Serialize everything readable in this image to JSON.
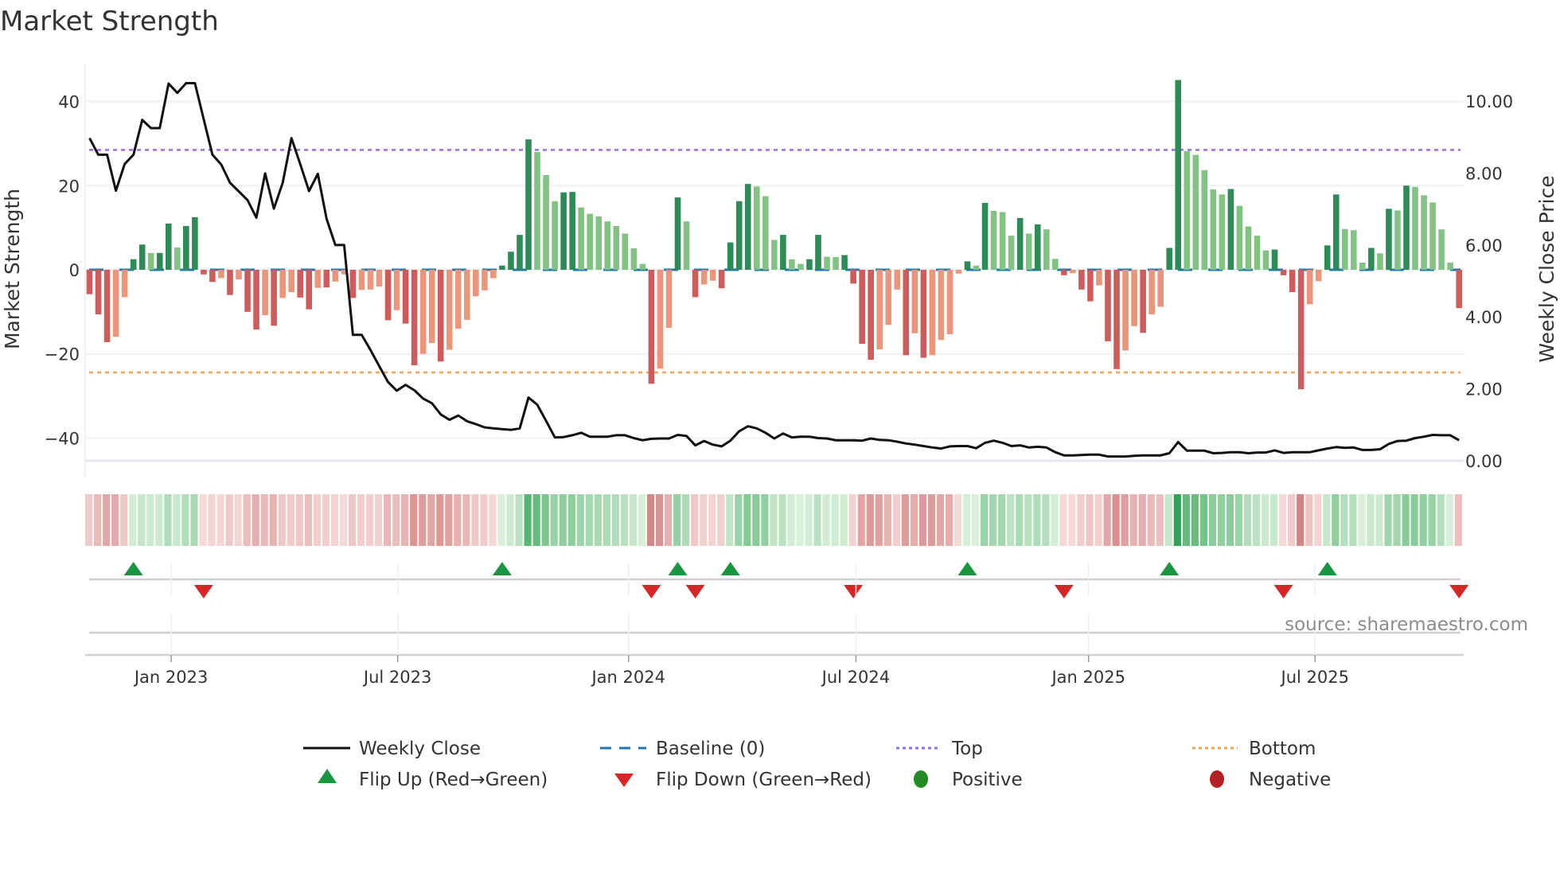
{
  "title": "Market Strength",
  "source": "source: sharemaestro.com",
  "colors": {
    "strong_pos": "#2e8b57",
    "weak_pos": "#82c283",
    "strong_neg": "#cd5c5c",
    "weak_neg": "#e9967a",
    "line": "#111111",
    "baseline": "#1f77b4",
    "top": "#9370db",
    "bottom": "#f4a460",
    "flip_up": "#1a9641",
    "flip_down": "#d62728",
    "positive": "#228b22",
    "negative": "#b22222"
  },
  "legend": [
    {
      "label": "Weekly Close",
      "icon": "solid-line"
    },
    {
      "label": "Baseline (0)",
      "icon": "dashed-line"
    },
    {
      "label": "Top",
      "icon": "dotted-line-purple"
    },
    {
      "label": "Bottom",
      "icon": "dotted-line-orange"
    },
    {
      "label": "Flip Up (Red→Green)",
      "icon": "triangle-up"
    },
    {
      "label": "Flip Down (Green→Red)",
      "icon": "triangle-down"
    },
    {
      "label": "Positive",
      "icon": "circle-green"
    },
    {
      "label": "Negative",
      "icon": "circle-red"
    }
  ],
  "chart_data": {
    "type": "bar",
    "title": "Market Strength",
    "ylabel": "Market Strength",
    "y2label": "Weekly Close Price",
    "ylim": [
      -45.4,
      48.8
    ],
    "y2lim": [
      0,
      11.02
    ],
    "yticks": [
      -40,
      -20,
      0,
      20,
      40
    ],
    "ytick_labels": [
      "−40",
      "−20",
      "0",
      "20",
      "40"
    ],
    "y2ticks": [
      0,
      2,
      4,
      6,
      8,
      10
    ],
    "y2tick_labels": [
      "0.00",
      "2.00",
      "4.00",
      "6.00",
      "8.00",
      "10.00"
    ],
    "xticks": [
      {
        "week": 10.3,
        "label": "Jan 2023"
      },
      {
        "week": 36.1,
        "label": "Jul 2023"
      },
      {
        "week": 62.4,
        "label": "Jan 2024"
      },
      {
        "week": 88.3,
        "label": "Jul 2024"
      },
      {
        "week": 114.8,
        "label": "Jan 2025"
      },
      {
        "week": 140.6,
        "label": "Jul 2025"
      }
    ],
    "top_level": 28.5,
    "bottom_level": -24.4,
    "baseline": 0,
    "grid": true,
    "legend_position": "bottom",
    "strength": [
      -5.8,
      -10.6,
      -17.2,
      -15.9,
      -6.5,
      2.5,
      6,
      4,
      4,
      11,
      5.3,
      10.4,
      12.5,
      -1.1,
      -2.9,
      -2,
      -6,
      -2.3,
      -10,
      -14.2,
      -10.8,
      -13.3,
      -6.7,
      -5.3,
      -6.6,
      -9.4,
      -4.3,
      -4.2,
      -2.8,
      -1.1,
      -6.7,
      -4.8,
      -4.7,
      -4,
      -12,
      -9.6,
      -12.8,
      -22.7,
      -20,
      -17.4,
      -21.8,
      -19,
      -14,
      -11.9,
      -6.3,
      -4.9,
      -2,
      1,
      4.3,
      8.3,
      31,
      28,
      22.5,
      16.3,
      18.4,
      18.5,
      14.8,
      13.3,
      12.7,
      11.5,
      10.4,
      8.6,
      5.1,
      1.4,
      -27.1,
      -23.5,
      -13.8,
      17.2,
      11.5,
      -6.5,
      -3.5,
      -2.6,
      -4.4,
      6.5,
      16.3,
      20.4,
      19.8,
      17.5,
      7.1,
      8.3,
      2.5,
      1.4,
      2.5,
      8.3,
      3.1,
      3,
      3.5,
      -3.3,
      -17.6,
      -21.4,
      -18.9,
      -13.1,
      -4.7,
      -20.3,
      -15.1,
      -20.9,
      -20.3,
      -16.7,
      -15.3,
      -0.9,
      2,
      1,
      15.9,
      14,
      13.7,
      8.1,
      12.3,
      8.6,
      10.8,
      9.6,
      2.6,
      -1.3,
      -0.8,
      -4.7,
      -7.5,
      -3.7,
      -17,
      -23.6,
      -19.2,
      -13.4,
      -15,
      -10.6,
      -8.8,
      5.2,
      45.1,
      28.2,
      27.3,
      23.7,
      19.1,
      17.9,
      19.2,
      15.2,
      10.3,
      8.1,
      4.6,
      4.8,
      -1.3,
      -5.3,
      -28.4,
      -8.2,
      -2.7,
      5.8,
      17.9,
      9.7,
      9.4,
      1.7,
      5.2,
      3.9,
      14.5,
      14.1,
      20,
      19.7,
      17.7,
      16,
      9.6,
      1.7,
      -9.1
    ],
    "strengthening": [
      1,
      1,
      1,
      0,
      0,
      1,
      1,
      0,
      1,
      1,
      0,
      1,
      1,
      1,
      1,
      0,
      1,
      0,
      1,
      1,
      0,
      1,
      0,
      0,
      1,
      1,
      0,
      1,
      0,
      0,
      1,
      0,
      0,
      0,
      1,
      0,
      1,
      1,
      0,
      0,
      1,
      0,
      0,
      0,
      0,
      0,
      0,
      1,
      1,
      1,
      1,
      0,
      0,
      0,
      1,
      1,
      0,
      0,
      0,
      0,
      0,
      0,
      0,
      0,
      1,
      0,
      0,
      1,
      0,
      1,
      0,
      0,
      1,
      1,
      1,
      1,
      0,
      0,
      0,
      1,
      0,
      0,
      1,
      1,
      0,
      0,
      1,
      1,
      1,
      1,
      0,
      0,
      0,
      1,
      0,
      1,
      0,
      0,
      0,
      0,
      1,
      0,
      1,
      0,
      0,
      0,
      1,
      0,
      1,
      0,
      0,
      1,
      0,
      1,
      1,
      0,
      1,
      1,
      0,
      0,
      1,
      0,
      0,
      1,
      1,
      0,
      0,
      0,
      0,
      0,
      1,
      0,
      0,
      0,
      0,
      1,
      1,
      1,
      1,
      0,
      0,
      1,
      1,
      0,
      0,
      0,
      1,
      0,
      1,
      0,
      1,
      0,
      0,
      0,
      0,
      0,
      1
    ],
    "weekly_close": [
      8.97,
      8.51,
      8.51,
      7.51,
      8.25,
      8.51,
      9.48,
      9.25,
      9.25,
      10.49,
      10.23,
      10.5,
      10.5,
      9.5,
      8.51,
      8.24,
      7.73,
      7.49,
      7.25,
      6.76,
      7.99,
      7.01,
      7.73,
      8.97,
      8.25,
      7.5,
      7.98,
      6.73,
      6.0,
      6.0,
      3.5,
      3.5,
      3.08,
      2.63,
      2.19,
      1.95,
      2.11,
      1.96,
      1.73,
      1.6,
      1.29,
      1.14,
      1.26,
      1.1,
      1.02,
      0.93,
      0.9,
      0.88,
      0.86,
      0.9,
      1.76,
      1.56,
      1.11,
      0.65,
      0.66,
      0.71,
      0.78,
      0.67,
      0.67,
      0.67,
      0.71,
      0.71,
      0.63,
      0.57,
      0.61,
      0.62,
      0.62,
      0.72,
      0.69,
      0.43,
      0.55,
      0.45,
      0.4,
      0.56,
      0.82,
      0.96,
      0.9,
      0.78,
      0.62,
      0.76,
      0.65,
      0.67,
      0.67,
      0.63,
      0.62,
      0.57,
      0.57,
      0.57,
      0.56,
      0.62,
      0.58,
      0.57,
      0.53,
      0.48,
      0.45,
      0.41,
      0.37,
      0.34,
      0.4,
      0.41,
      0.41,
      0.35,
      0.5,
      0.56,
      0.5,
      0.41,
      0.43,
      0.37,
      0.39,
      0.37,
      0.24,
      0.15,
      0.15,
      0.16,
      0.17,
      0.17,
      0.12,
      0.12,
      0.12,
      0.14,
      0.15,
      0.15,
      0.15,
      0.21,
      0.52,
      0.28,
      0.28,
      0.28,
      0.21,
      0.22,
      0.24,
      0.24,
      0.21,
      0.23,
      0.23,
      0.29,
      0.22,
      0.24,
      0.24,
      0.24,
      0.29,
      0.34,
      0.38,
      0.36,
      0.37,
      0.3,
      0.3,
      0.32,
      0.47,
      0.55,
      0.56,
      0.63,
      0.67,
      0.72,
      0.71,
      0.71,
      0.57
    ]
  }
}
